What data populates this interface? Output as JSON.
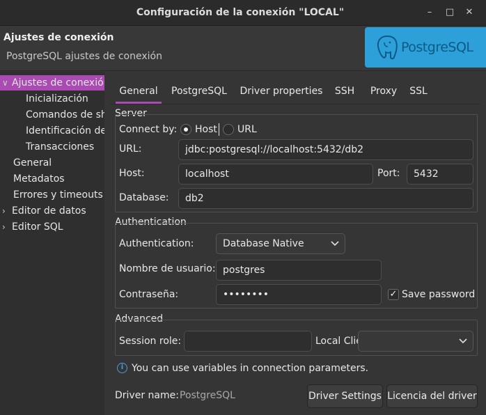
{
  "window": {
    "title": "Configuración de la conexión \"LOCAL\"",
    "minimize_glyph": "–",
    "maximize_glyph": "□",
    "close_glyph": "✕"
  },
  "header": {
    "title": "Ajustes de conexión",
    "subtitle": "PostgreSQL ajustes de conexión",
    "logo_text": "PostgreSQL",
    "logo_icon": "postgresql-elephant-icon",
    "logo_color": "#2d9fd9"
  },
  "sidebar": {
    "items": [
      {
        "label": "Ajustes de conexión",
        "arrow": "∨",
        "selected": true
      },
      {
        "label": "Inicialización"
      },
      {
        "label": "Comandos de she"
      },
      {
        "label": "Identificación de"
      },
      {
        "label": "Transacciones"
      },
      {
        "label": "General"
      },
      {
        "label": "Metadatos"
      },
      {
        "label": "Errores y timeouts"
      },
      {
        "label": "Editor de datos",
        "arrow": "›"
      },
      {
        "label": "Editor SQL",
        "arrow": "›"
      }
    ]
  },
  "tabs": [
    "General",
    "PostgreSQL",
    "Driver properties",
    "SSH",
    "Proxy",
    "SSL"
  ],
  "server": {
    "group_title": "Server",
    "connect_by_label": "Connect by:",
    "radio_host": "Host",
    "radio_url": "URL",
    "url_label": "URL:",
    "url_value": "jdbc:postgresql://localhost:5432/db2",
    "host_label": "Host:",
    "host_value": "localhost",
    "port_label": "Port:",
    "port_value": "5432",
    "database_label": "Database:",
    "database_value": "db2"
  },
  "auth": {
    "group_title": "Authentication",
    "auth_label": "Authentication:",
    "auth_value": "Database Native",
    "user_label": "Nombre de usuario:",
    "user_value": "postgres",
    "password_label": "Contraseña:",
    "password_value": "••••••••",
    "save_password_label": "Save password",
    "save_password_checked": true
  },
  "advanced": {
    "group_title": "Advanced",
    "session_role_label": "Session role:",
    "session_role_value": "",
    "local_client_label": "Local Client:",
    "local_client_value": ""
  },
  "info_text": "You can use variables in connection parameters.",
  "footer": {
    "driver_name_label": "Driver name:",
    "driver_name_value": "PostgreSQL",
    "driver_settings_button": "Driver Settings",
    "license_button": "Licencia del driver"
  },
  "colors": {
    "accent": "#a94bb3",
    "info": "#4a9ee0",
    "background": "#353535"
  }
}
